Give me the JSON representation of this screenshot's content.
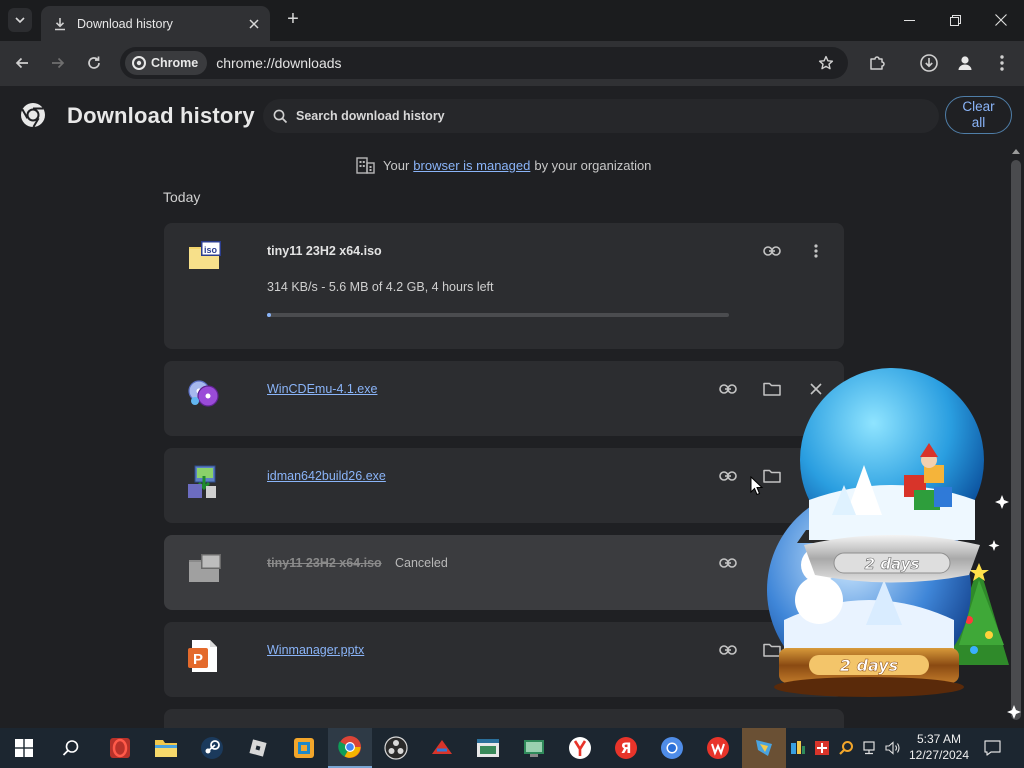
{
  "window": {
    "tab_title": "Download history",
    "new_tab_label": "+",
    "controls": {
      "minimize": "minimize",
      "restore": "restore",
      "close": "close"
    }
  },
  "toolbar": {
    "chip_label": "Chrome",
    "url": "chrome://downloads"
  },
  "page": {
    "title": "Download history",
    "search_placeholder": "Search download history",
    "clear_all_label": "Clear all"
  },
  "managed": {
    "prefix": "Your",
    "link": "browser is managed",
    "suffix": "by your organization"
  },
  "section_label": "Today",
  "downloads": [
    {
      "name": "tiny11 23H2 x64.iso",
      "state": "in-progress",
      "status": "314 KB/s - 5.6 MB of 4.2 GB, 4 hours left",
      "progress": 0.0013,
      "icon": "iso-file-icon"
    },
    {
      "name": "WinCDEmu-4.1.exe",
      "state": "complete",
      "icon": "discs-app-icon"
    },
    {
      "name": "idman642build26.exe",
      "state": "complete",
      "icon": "installer-app-icon"
    },
    {
      "name": "tiny11 23H2 x64.iso",
      "state": "canceled",
      "status": "Canceled",
      "icon": "generic-file-icon"
    },
    {
      "name": "Winmanager.pptx",
      "state": "complete",
      "icon": "powerpoint-file-icon"
    }
  ],
  "overlay": {
    "globe_label_top": "2 days",
    "globe_label_bottom": "2 days"
  },
  "taskbar": {
    "apps": [
      "start-icon",
      "search-icon",
      "opera-gx-icon",
      "file-explorer-icon",
      "steam-icon",
      "roblox-icon",
      "app-icon",
      "chrome-icon",
      "obs-icon",
      "game-icon",
      "window-app-icon",
      "system-app-icon",
      "yandex-icon",
      "yandex-browser-icon",
      "chromium-icon",
      "wps-icon",
      "winmanager-icon"
    ],
    "time": "5:37 AM",
    "date": "12/27/2024"
  },
  "colors": {
    "accent": "#8ab4f8",
    "page_bg": "#1f2023",
    "card_bg": "#2c2d30",
    "taskbar_bg": "#1c2630"
  }
}
